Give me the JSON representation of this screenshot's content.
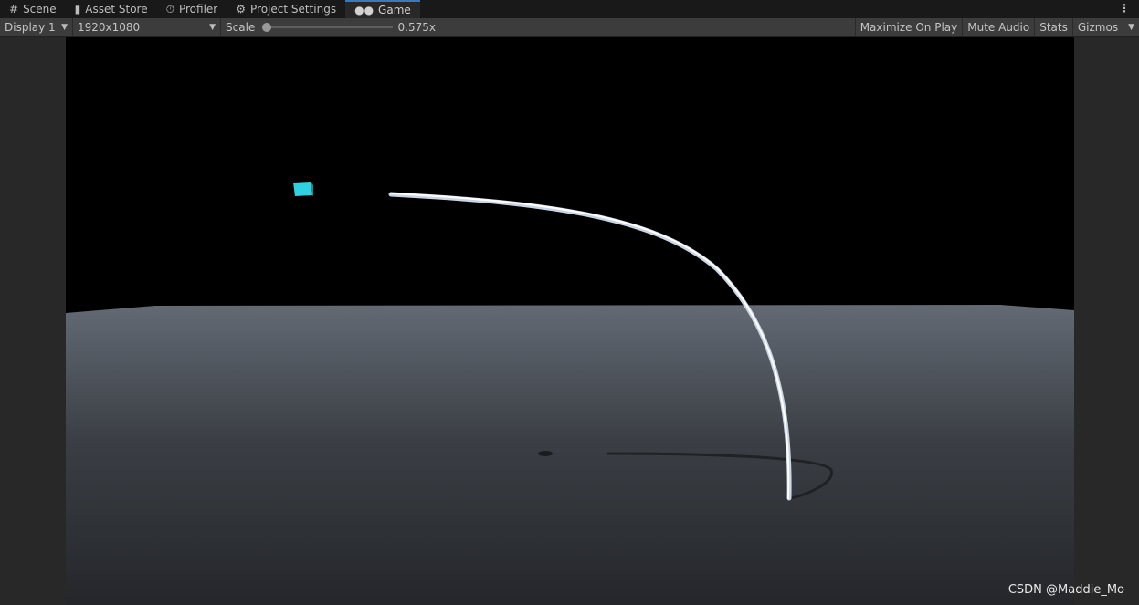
{
  "tabs": [
    {
      "label": "Scene",
      "icon": "grid-icon"
    },
    {
      "label": "Asset Store",
      "icon": "shopping-bag-icon"
    },
    {
      "label": "Profiler",
      "icon": "stopwatch-icon"
    },
    {
      "label": "Project Settings",
      "icon": "gear-icon"
    },
    {
      "label": "Game",
      "icon": "gamepad-icon",
      "active": true
    }
  ],
  "toolbar": {
    "display": "Display 1",
    "resolution": "1920x1080",
    "scale_label": "Scale",
    "scale_value": "0.575x",
    "maximize": "Maximize On Play",
    "mute": "Mute Audio",
    "stats": "Stats",
    "gizmos": "Gizmos"
  },
  "scene": {
    "cube_color": "#2fd0e0",
    "sky_color": "#000000",
    "floor_color": "#5f6670"
  },
  "watermark": "CSDN @Maddie_Mo"
}
